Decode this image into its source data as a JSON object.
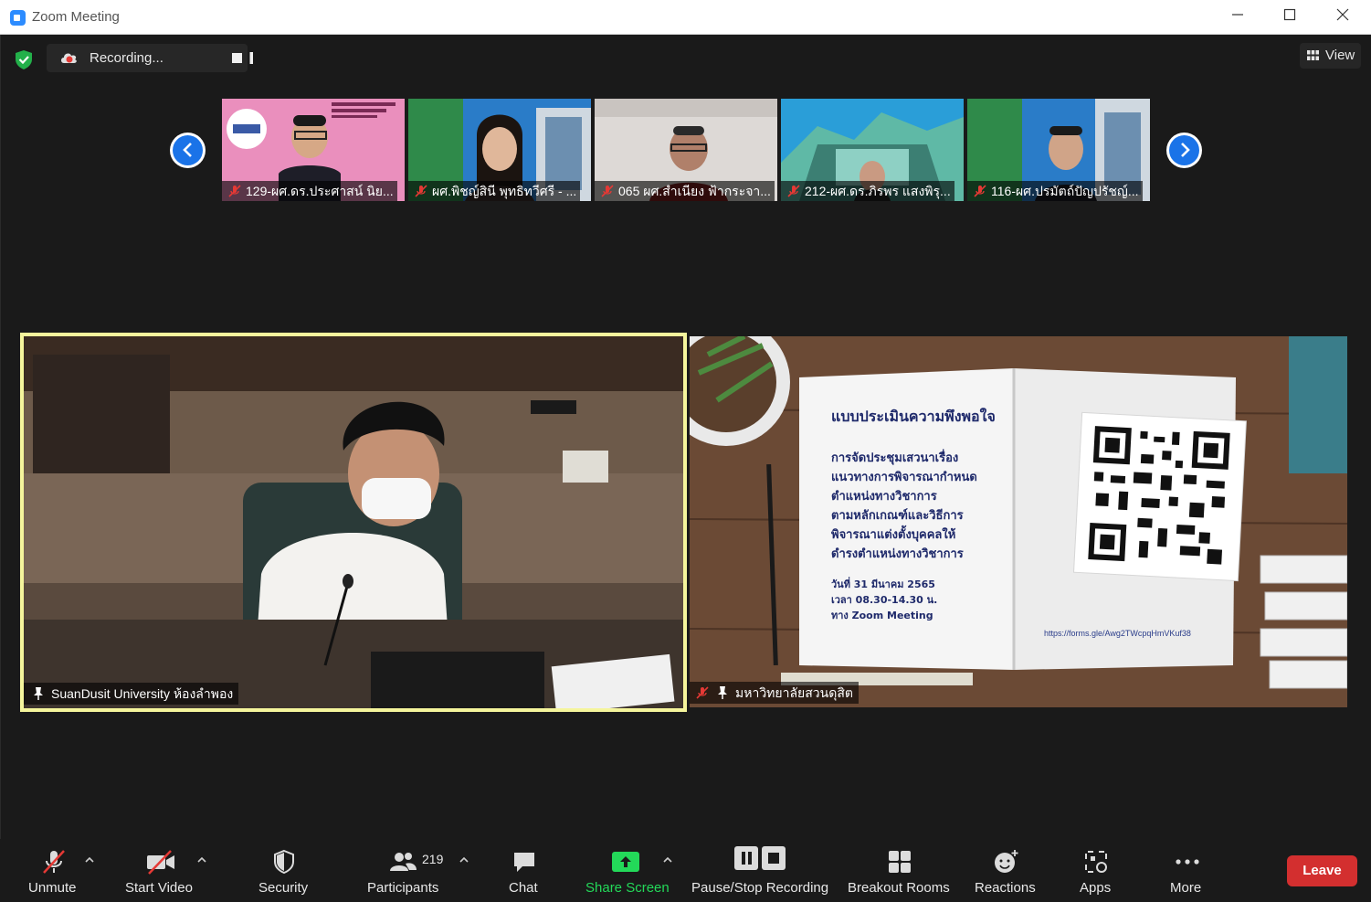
{
  "window": {
    "title": "Zoom Meeting",
    "controls": [
      "minimize-icon",
      "maximize-icon",
      "close-icon"
    ]
  },
  "top_bar": {
    "security_indicator": "shield-check-icon",
    "recording": {
      "label": "Recording...",
      "pause_icon": "pause-icon",
      "stop_icon": "stop-icon"
    },
    "view_button": {
      "label": "View",
      "icon": "grid-icon"
    }
  },
  "gallery_strip": {
    "prev_icon": "chevron-left-icon",
    "next_icon": "chevron-right-icon",
    "participants": [
      {
        "name": "129-ผศ.ดร.ประศาสน์ นิย...",
        "muted": true
      },
      {
        "name": "ผศ.พิชญ์สินี พุทธิทวีศรี - ...",
        "muted": true
      },
      {
        "name": "065 ผศ.สำเนียง ฟ้ากระจา...",
        "muted": true
      },
      {
        "name": "212-ผศ.ดร.ภิรพร แสงพิรุ...",
        "muted": true
      },
      {
        "name": "116-ผศ.ปรมัตถ์ปัญปรัชญ์...",
        "muted": true
      }
    ]
  },
  "main_tiles": {
    "left": {
      "name": "SuanDusit University ห้องลำพอง",
      "active_speaker": true,
      "pinned": true
    },
    "right": {
      "name": "มหาวิทยาลัยสวนดุสิต",
      "muted": true,
      "pinned": true,
      "slide": {
        "title": "แบบประเมินความพึงพอใจ",
        "lines": [
          "การจัดประชุมเสวนาเรื่อง",
          "แนวทางการพิจารณากำหนด",
          "ตำแหน่งทางวิชาการ",
          "ตามหลักเกณฑ์และวิธีการ",
          "พิจารณาแต่งตั้งบุคคลให้",
          "ดำรงตำแหน่งทางวิชาการ"
        ],
        "date_lines": [
          "วันที่ 31 มีนาคม 2565",
          "เวลา 08.30-14.30 น.",
          "ทาง Zoom Meeting"
        ],
        "link": "https://forms.gle/Awg2TWcpqHmVKuf38"
      }
    }
  },
  "toolbar": {
    "unmute": "Unmute",
    "start_video": "Start Video",
    "security": "Security",
    "participants": "Participants",
    "participants_count": "219",
    "chat": "Chat",
    "share_screen": "Share Screen",
    "recording": "Pause/Stop Recording",
    "breakout_rooms": "Breakout Rooms",
    "reactions": "Reactions",
    "apps": "Apps",
    "more": "More",
    "leave": "Leave",
    "colors": {
      "share_green": "#23d959",
      "leave_red": "#d32f2f",
      "muted_red": "#e53935"
    }
  }
}
